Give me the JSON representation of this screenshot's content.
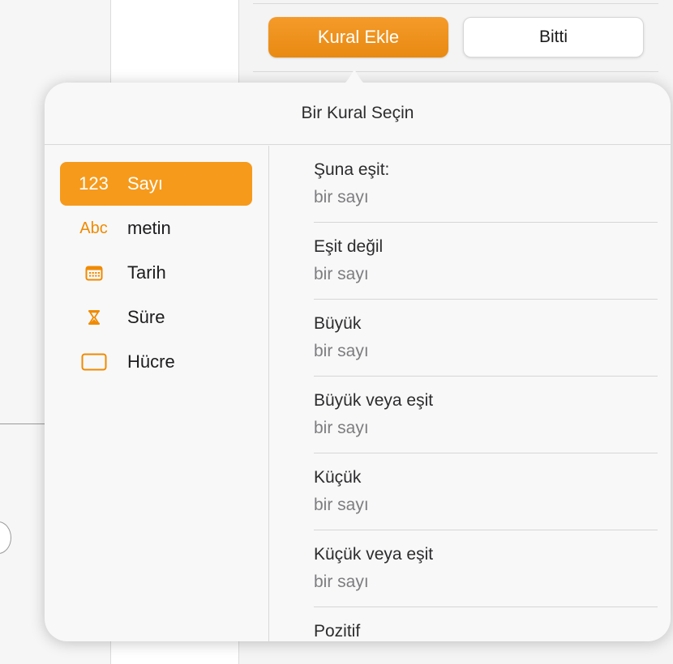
{
  "toolbar": {
    "add_rule_label": "Kural Ekle",
    "done_label": "Bitti"
  },
  "popover": {
    "title": "Bir Kural Seçin"
  },
  "categories": [
    {
      "icon_text": "123",
      "label": "Sayı",
      "selected": true,
      "icon": "number-icon"
    },
    {
      "icon_text": "Abc",
      "label": "metin",
      "selected": false,
      "icon": "text-icon"
    },
    {
      "icon_text": "",
      "label": "Tarih",
      "selected": false,
      "icon": "calendar-icon"
    },
    {
      "icon_text": "",
      "label": "Süre",
      "selected": false,
      "icon": "hourglass-icon"
    },
    {
      "icon_text": "",
      "label": "Hücre",
      "selected": false,
      "icon": "cell-icon"
    }
  ],
  "rules": [
    {
      "title": "Şuna eşit:",
      "subtitle": "bir sayı"
    },
    {
      "title": "Eşit değil",
      "subtitle": "bir sayı"
    },
    {
      "title": "Büyük",
      "subtitle": "bir sayı"
    },
    {
      "title": "Büyük veya eşit",
      "subtitle": "bir sayı"
    },
    {
      "title": "Küçük",
      "subtitle": "bir sayı"
    },
    {
      "title": "Küçük veya eşit",
      "subtitle": "bir sayı"
    },
    {
      "title": "Pozitif",
      "subtitle": ""
    }
  ],
  "colors": {
    "accent": "#F69A1C",
    "accent_icon": "#F08A00"
  }
}
